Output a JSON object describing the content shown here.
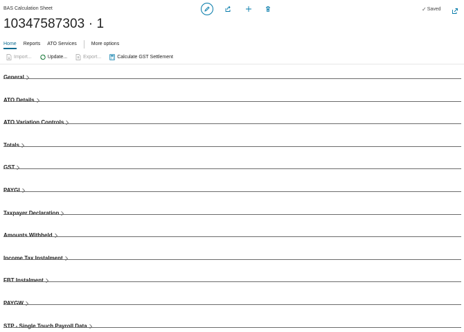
{
  "header": {
    "caption": "BAS Calculation Sheet",
    "title": "10347587303 · 1",
    "status": "Saved"
  },
  "icons": {
    "edit": "pencil-icon",
    "share": "share-icon",
    "new": "plus-icon",
    "delete": "trash-icon",
    "popout": "popout-icon"
  },
  "tabs": [
    {
      "label": "Home",
      "active": true
    },
    {
      "label": "Reports"
    },
    {
      "label": "ATO Services"
    },
    {
      "label": "More options"
    }
  ],
  "actions": [
    {
      "label": "Import...",
      "enabled": false
    },
    {
      "label": "Update...",
      "enabled": true
    },
    {
      "label": "Export...",
      "enabled": false
    },
    {
      "label": "Calculate GST Settlement",
      "enabled": true
    }
  ],
  "sections": [
    {
      "label": "General"
    },
    {
      "label": "ATO Details"
    },
    {
      "label": "ATO Variation Controls"
    },
    {
      "label": "Totals"
    },
    {
      "label": "GST"
    },
    {
      "label": "PAYGI"
    },
    {
      "label": "Taxpayer Declaration"
    },
    {
      "label": "Amounts Withheld"
    },
    {
      "label": "Income Tax Instalment"
    },
    {
      "label": "FBT Instalment"
    },
    {
      "label": "PAYGW"
    },
    {
      "label": "STP - Single Touch Payroll Data"
    }
  ]
}
